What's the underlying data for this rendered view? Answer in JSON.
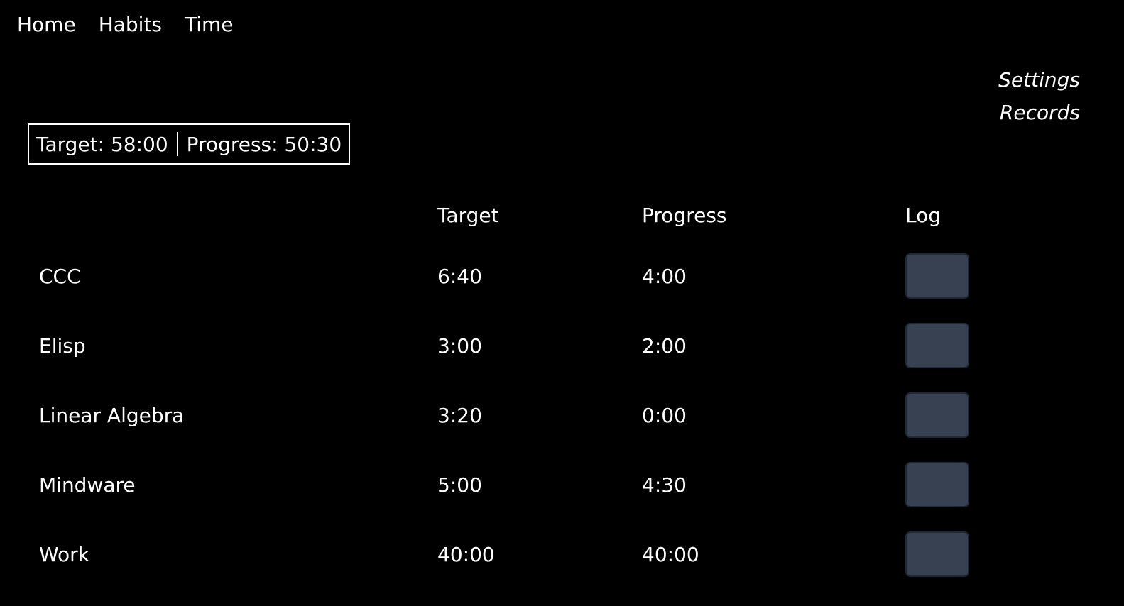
{
  "nav": {
    "items": [
      {
        "label": "Home"
      },
      {
        "label": "Habits"
      },
      {
        "label": "Time"
      }
    ]
  },
  "side_links": {
    "settings": "Settings",
    "records": "Records"
  },
  "summary": {
    "target_text": "Target: 58:00",
    "progress_text": "Progress: 50:30"
  },
  "table": {
    "headers": {
      "target": "Target",
      "progress": "Progress",
      "log": "Log"
    },
    "rows": [
      {
        "name": "CCC",
        "target": "6:40",
        "progress": "4:00"
      },
      {
        "name": "Elisp",
        "target": "3:00",
        "progress": "2:00"
      },
      {
        "name": "Linear Algebra",
        "target": "3:20",
        "progress": "0:00"
      },
      {
        "name": "Mindware",
        "target": "5:00",
        "progress": "4:30"
      },
      {
        "name": "Work",
        "target": "40:00",
        "progress": "40:00"
      }
    ]
  },
  "colors": {
    "background": "#000000",
    "text": "#ffffff",
    "log_button": "#374151"
  }
}
